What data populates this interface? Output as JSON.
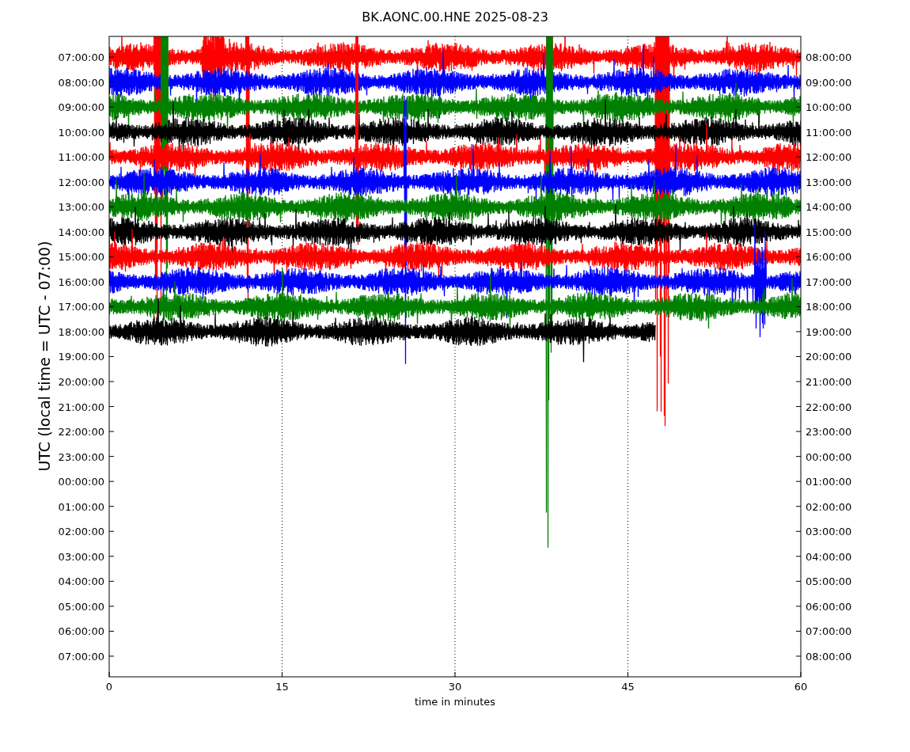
{
  "title": "BK.AONC.00.HNE 2025-08-23",
  "ylabel": "UTC (local time = UTC - 07:00)",
  "xlabel": "time in minutes",
  "xticks": [
    "0",
    "15",
    "30",
    "45",
    "60"
  ],
  "left_ticks": [
    "07:00:00",
    "08:00:00",
    "09:00:00",
    "10:00:00",
    "11:00:00",
    "12:00:00",
    "13:00:00",
    "14:00:00",
    "15:00:00",
    "16:00:00",
    "17:00:00",
    "18:00:00",
    "19:00:00",
    "20:00:00",
    "21:00:00",
    "22:00:00",
    "23:00:00",
    "00:00:00",
    "01:00:00",
    "02:00:00",
    "03:00:00",
    "04:00:00",
    "05:00:00",
    "06:00:00",
    "07:00:00"
  ],
  "right_ticks": [
    "08:00:00",
    "09:00:00",
    "10:00:00",
    "11:00:00",
    "12:00:00",
    "13:00:00",
    "14:00:00",
    "15:00:00",
    "16:00:00",
    "17:00:00",
    "18:00:00",
    "19:00:00",
    "20:00:00",
    "21:00:00",
    "22:00:00",
    "23:00:00",
    "00:00:00",
    "01:00:00",
    "02:00:00",
    "03:00:00",
    "04:00:00",
    "05:00:00",
    "06:00:00",
    "07:00:00",
    "08:00:00"
  ],
  "traces": [
    {
      "color": "#ff0000"
    },
    {
      "color": "#0000ff"
    },
    {
      "color": "#008000"
    },
    {
      "color": "#000000"
    },
    {
      "color": "#ff0000"
    },
    {
      "color": "#0000ff"
    },
    {
      "color": "#008000"
    },
    {
      "color": "#000000"
    },
    {
      "color": "#ff0000"
    },
    {
      "color": "#0000ff"
    },
    {
      "color": "#008000"
    },
    {
      "color": "#000000"
    }
  ]
}
